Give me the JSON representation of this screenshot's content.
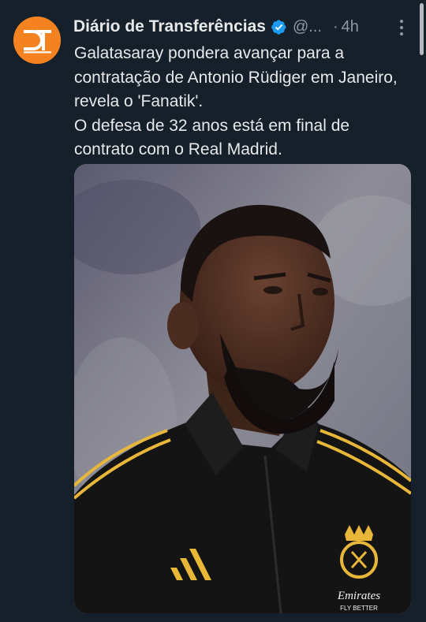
{
  "tweet": {
    "author": {
      "name": "Diário de Transferências",
      "handle": "@...",
      "avatar_initials": "DT",
      "verified": true,
      "avatar_color": "#f58220"
    },
    "separator": "·",
    "time": "4h",
    "text_lines": [
      "Galatasaray pondera avançar para a contratação de Antonio Rüdiger em Janeiro, revela o 'Fanatik'.",
      "O defesa de 32 anos está em final de contrato com o Real Madrid."
    ],
    "media": {
      "sponsor_line1": "Emirates",
      "sponsor_line2": "FLY BETTER"
    }
  },
  "colors": {
    "background": "#15202b",
    "text": "#e7e9ea",
    "secondary_text": "#8b98a5",
    "verified_badge": "#1d9bf0",
    "jersey_stripe": "#e8b73a"
  }
}
